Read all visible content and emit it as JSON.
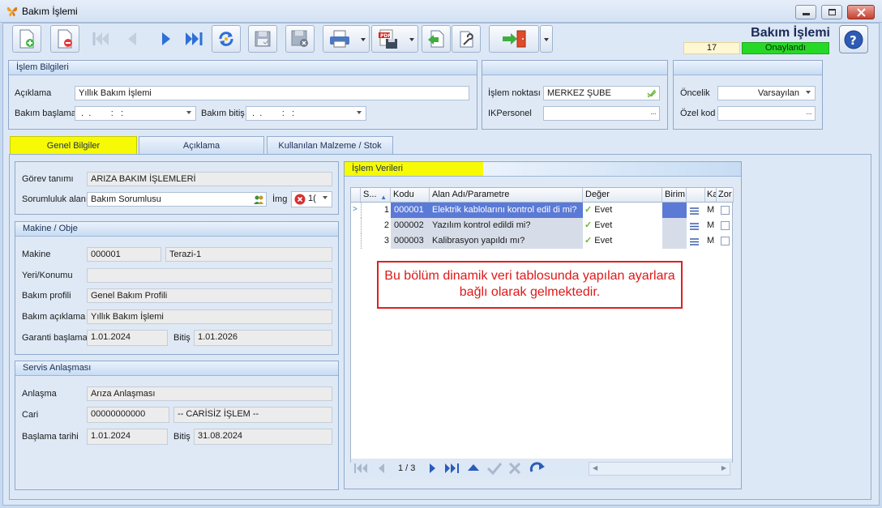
{
  "window": {
    "title": "Bakım İşlemi"
  },
  "header": {
    "title": "Bakım İşlemi",
    "record_no": "17",
    "status": "Onaylandı",
    "status_color": "#27d927"
  },
  "toolbar": {
    "buttons": [
      "new-record-icon",
      "delete-record-icon",
      "first-record-icon",
      "previous-record-icon",
      "next-record-icon",
      "last-record-icon",
      "refresh-icon",
      "save-icon",
      "cancel-save-icon",
      "print-icon",
      "pdf-export-icon",
      "import-icon",
      "settings-icon",
      "exit-icon"
    ]
  },
  "islem_bilgileri": {
    "title": "İşlem Bilgileri",
    "aciklama_label": "Açıklama",
    "aciklama_value": "Yıllık Bakım İşlemi",
    "bakim_baslama_label": "Bakım başlama",
    "bakim_baslama_value": " .  .        :   :",
    "bakim_bitis_label": "Bakım bitiş",
    "bakim_bitis_value": " .  .        :   :"
  },
  "islem_noktasi": {
    "label": "İşlem noktası",
    "value": "MERKEZ ŞUBE",
    "ik_label": "IKPersonel",
    "ik_value": ""
  },
  "oncelik": {
    "label": "Öncelik",
    "value": "Varsayılan",
    "ozel_kod_label": "Özel kod",
    "ozel_kod_value": ""
  },
  "tabs": [
    {
      "label": "Genel Bilgiler",
      "active": true
    },
    {
      "label": "Açıklama",
      "active": false
    },
    {
      "label": "Kullanılan Malzeme / Stok",
      "active": false
    }
  ],
  "gorev": {
    "gorev_label": "Görev tanımı",
    "gorev_value": "ARIZA BAKIM İŞLEMLERİ",
    "sorumluluk_label": "Sorumluluk alanı",
    "sorumluluk_value": "Bakım Sorumlusu",
    "img_label": "İmg",
    "img_value": "1("
  },
  "makine": {
    "title": "Makine / Obje",
    "makine_label": "Makine",
    "makine_code": "000001",
    "makine_name": "Terazi-1",
    "yeri_label": "Yeri/Konumu",
    "yeri_value": "",
    "profil_label": "Bakım profili",
    "profil_value": "Genel Bakım Profili",
    "aciklama_label": "Bakım açıklama",
    "aciklama_value": "Yıllık Bakım İşlemi",
    "garanti_label": "Garanti başlama",
    "garanti_value": "1.01.2024",
    "bitis_label": "Bitiş",
    "bitis_value": "1.01.2026"
  },
  "servis": {
    "title": "Servis Anlaşması",
    "anlasma_label": "Anlaşma",
    "anlasma_value": "Arıza Anlaşması",
    "cari_label": "Cari",
    "cari_code": "00000000000",
    "cari_name": "-- CARİSİZ İŞLEM --",
    "baslama_label": "Başlama tarihi",
    "baslama_value": "1.01.2024",
    "bitis_label": "Bitiş",
    "bitis_value": "31.08.2024"
  },
  "islem_verileri": {
    "title": "İşlem Verileri",
    "columns": [
      "S...",
      "Kodu",
      "Alan Adı/Parametre",
      "Değer",
      "Birim",
      "",
      "Ka",
      "Zor"
    ],
    "rows": [
      {
        "s": "1",
        "kodu": "000001",
        "alan": "Elektrik kablolarını kontrol edil di mi?",
        "deger": "Evet",
        "ka": "M"
      },
      {
        "s": "2",
        "kodu": "000002",
        "alan": "Yazılım kontrol edildi mi?",
        "deger": "Evet",
        "ka": "M"
      },
      {
        "s": "3",
        "kodu": "000003",
        "alan": "Kalibrasyon yapıldı mı?",
        "deger": "Evet",
        "ka": "M"
      }
    ],
    "pager": "1 / 3",
    "note": "Bu bölüm dinamik veri tablosunda yapılan ayarlara bağlı olarak gelmektedir."
  }
}
